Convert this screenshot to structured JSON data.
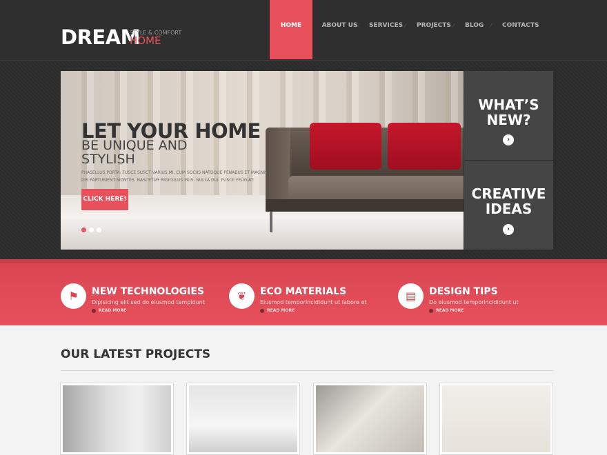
{
  "brand": {
    "name": "DREAM",
    "tagline": "STYLE & COMFORT",
    "sub": "HOME",
    "colors": {
      "accent": "#e8505b",
      "dark": "#2f2f2f",
      "panel": "#454545"
    }
  },
  "nav": {
    "items": [
      {
        "label": "HOME",
        "active": true
      },
      {
        "label": "ABOUT US",
        "active": false
      },
      {
        "label": "SERVICES",
        "active": false
      },
      {
        "label": "PROJECTS",
        "active": false
      },
      {
        "label": "BLOG",
        "active": false
      },
      {
        "label": "CONTACTS",
        "active": false
      }
    ]
  },
  "hero": {
    "title": "LET YOUR HOME",
    "subtitle": "BE UNIQUE AND STYLISH",
    "text": "PHASELLUS PORTA. FUSCE SUSCT VARIUS MI. CUM SOCIIS NATOQUE PENABUS ET MAGNIS DIS PARTURIENT MONTES, NASCETUR RIDICULUS MUS. NULLA DUI. FUSCE FEUGIAT.",
    "button_label": "CLICK HERE!",
    "slides_count": 3,
    "active_slide": 1
  },
  "panels": [
    {
      "title": "WHAT’S NEW?",
      "icon": "arrow-right-icon"
    },
    {
      "title": "CREATIVE IDEAS",
      "icon": "arrow-right-icon"
    }
  ],
  "features": [
    {
      "title": "NEW TECHNOLOGIES",
      "text": "Dipisicing elit sed do eiusmod tempidunt",
      "more": "READ MORE",
      "icon": "flag-icon"
    },
    {
      "title": "ECO MATERIALS",
      "text": "Eiusmod temporincididunt ut labore et",
      "more": "READ MORE",
      "icon": "leaf-icon"
    },
    {
      "title": "DESIGN TIPS",
      "text": "Do eiusmod temporincididunt ut",
      "more": "READ MORE",
      "icon": "book-icon"
    }
  ],
  "projects": {
    "title": "OUR LATEST PROJECTS"
  }
}
